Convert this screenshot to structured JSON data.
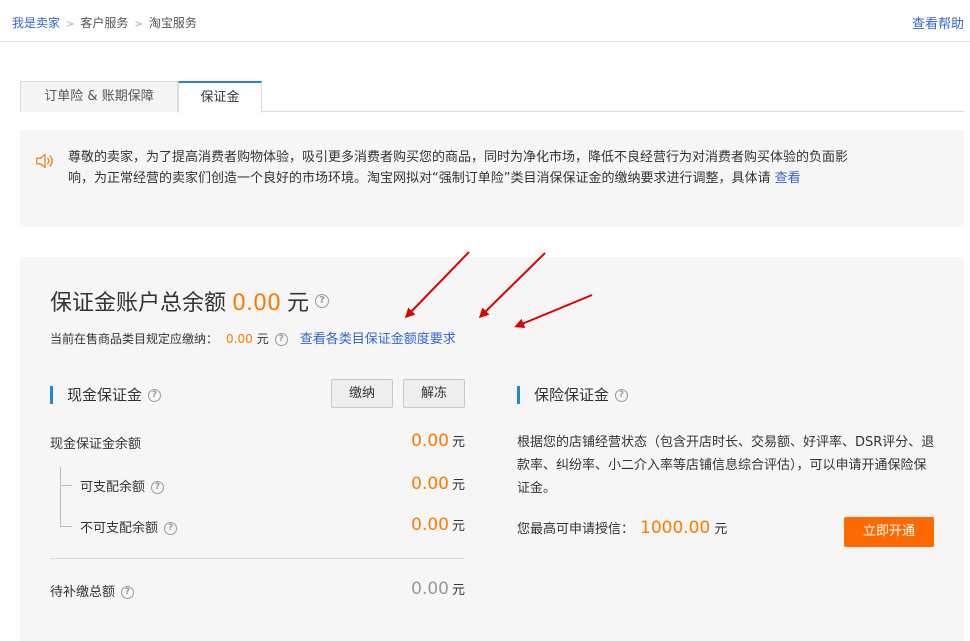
{
  "breadcrumb": {
    "items": [
      "我是卖家",
      "客户服务",
      "淘宝服务"
    ],
    "separator": ">"
  },
  "header": {
    "help_label": "查看帮助"
  },
  "tabs": [
    {
      "label": "订单险 & 账期保障",
      "active": false
    },
    {
      "label": "保证金",
      "active": true
    }
  ],
  "notice": {
    "text": "尊敬的卖家，为了提高消费者购物体验，吸引更多消费者购买您的商品，同时为净化市场，降低不良经营行为对消费者购买体验的负面影响，为正常经营的卖家们创造一个良好的市场环境。淘宝网拟对“强制订单险”类目消保保证金的缴纳要求进行调整，具体请",
    "link_label": "查看"
  },
  "account": {
    "title": "保证金账户总余额",
    "total_amount": "0.00",
    "unit": "元",
    "required_label": "当前在售商品类目规定应缴纳：",
    "required_amount": "0.00",
    "requirements_link": "查看各类目保证金额度要求"
  },
  "cash": {
    "title": "现金保证金",
    "pay_label": "缴纳",
    "unfreeze_label": "解冻",
    "rows": {
      "total_label": "现金保证金余额",
      "total_value": "0.00",
      "available_label": "可支配余额",
      "available_value": "0.00",
      "unavailable_label": "不可支配余额",
      "unavailable_value": "0.00",
      "pending_label": "待补缴总额",
      "pending_value": "0.00"
    },
    "unit": "元"
  },
  "insurance": {
    "title": "保险保证金",
    "description": "根据您的店铺经营状态（包含开店时长、交易额、好评率、DSR评分、退款率、纠纷率、小二介入率等店铺信息综合评估），可以申请开通保险保证金。",
    "credit_label": "您最高可申请授信：",
    "credit_amount": "1000.00",
    "unit": "元",
    "open_label": "立即开通"
  },
  "icons": {
    "speaker": "speaker-icon",
    "help": "question-circle-icon",
    "annotation": "red-arrow-annotation"
  },
  "colors": {
    "accent_blue": "#1f88d6",
    "link": "#3366cc",
    "amount_orange": "#ff7a00",
    "button_orange": "#ff6a00",
    "arrow_red": "#e00000"
  }
}
